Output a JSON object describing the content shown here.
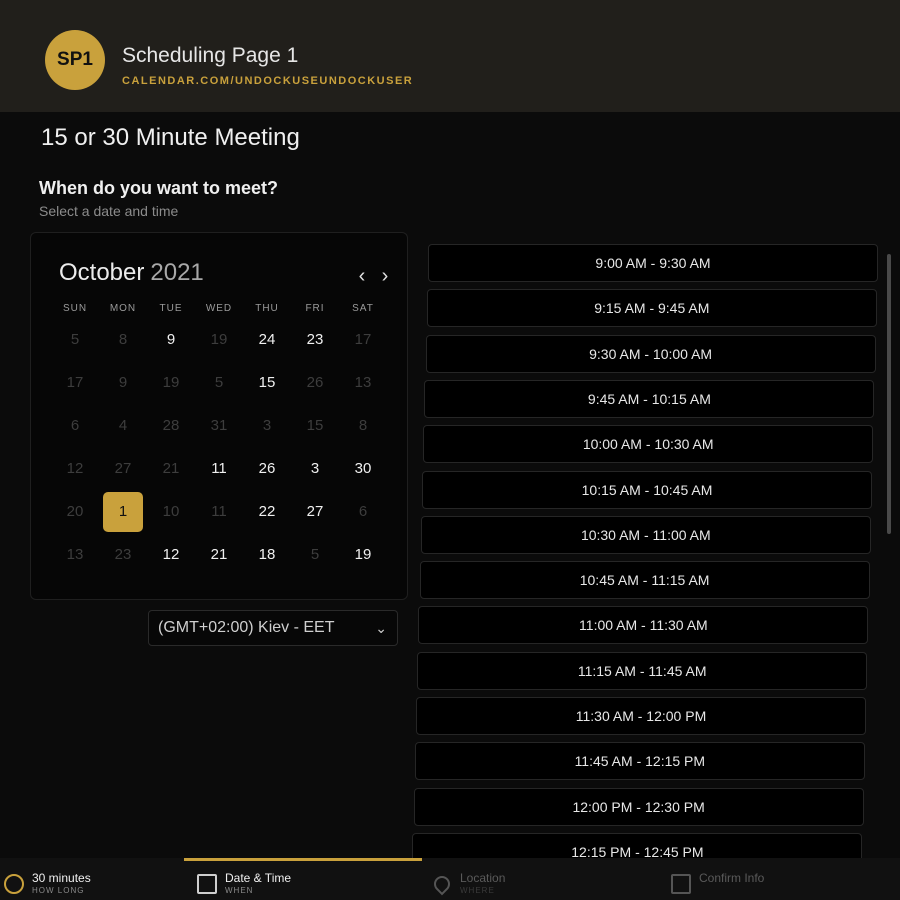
{
  "header": {
    "avatar_initials": "SP1",
    "page_name": "Scheduling Page 1",
    "page_url": "CALENDAR.COM/UNDOCKUSEUNDOCKUSER"
  },
  "meeting": {
    "title": "15 or 30 Minute Meeting",
    "question": "When do you want to meet?",
    "hint": "Select a date and time"
  },
  "calendar": {
    "month": "October",
    "year": "2021",
    "prev_icon": "‹",
    "next_icon": "›",
    "weekdays": [
      "SUN",
      "MON",
      "TUE",
      "WED",
      "THU",
      "FRI",
      "SAT"
    ],
    "weeks": [
      [
        {
          "d": "5",
          "a": false
        },
        {
          "d": "8",
          "a": false
        },
        {
          "d": "9",
          "a": true
        },
        {
          "d": "19",
          "a": false
        },
        {
          "d": "24",
          "a": true
        },
        {
          "d": "23",
          "a": true
        },
        {
          "d": "17",
          "a": false
        }
      ],
      [
        {
          "d": "17",
          "a": false
        },
        {
          "d": "9",
          "a": false
        },
        {
          "d": "19",
          "a": false
        },
        {
          "d": "5",
          "a": false
        },
        {
          "d": "15",
          "a": true
        },
        {
          "d": "26",
          "a": false
        },
        {
          "d": "13",
          "a": false
        }
      ],
      [
        {
          "d": "6",
          "a": false
        },
        {
          "d": "4",
          "a": false
        },
        {
          "d": "28",
          "a": false
        },
        {
          "d": "31",
          "a": false
        },
        {
          "d": "3",
          "a": false
        },
        {
          "d": "15",
          "a": false
        },
        {
          "d": "8",
          "a": false
        }
      ],
      [
        {
          "d": "12",
          "a": false
        },
        {
          "d": "27",
          "a": false
        },
        {
          "d": "21",
          "a": false
        },
        {
          "d": "11",
          "a": true
        },
        {
          "d": "26",
          "a": true
        },
        {
          "d": "3",
          "a": true
        },
        {
          "d": "30",
          "a": true
        }
      ],
      [
        {
          "d": "20",
          "a": false
        },
        {
          "d": "1",
          "a": true,
          "sel": true
        },
        {
          "d": "10",
          "a": false
        },
        {
          "d": "11",
          "a": false
        },
        {
          "d": "22",
          "a": true
        },
        {
          "d": "27",
          "a": true
        },
        {
          "d": "6",
          "a": false
        }
      ],
      [
        {
          "d": "13",
          "a": false
        },
        {
          "d": "23",
          "a": false
        },
        {
          "d": "12",
          "a": true
        },
        {
          "d": "21",
          "a": true
        },
        {
          "d": "18",
          "a": true
        },
        {
          "d": "5",
          "a": false
        },
        {
          "d": "19",
          "a": true
        }
      ]
    ]
  },
  "timezone": {
    "label": "(GMT+02:00) Kiev - EET",
    "chevron": "⌄"
  },
  "time_slots": [
    "9:00 AM - 9:30 AM",
    "9:15 AM - 9:45 AM",
    "9:30 AM - 10:00 AM",
    "9:45 AM - 10:15 AM",
    "10:00 AM - 10:30 AM",
    "10:15 AM - 10:45 AM",
    "10:30 AM - 11:00 AM",
    "10:45 AM - 11:15 AM",
    "11:00 AM - 11:30 AM",
    "11:15 AM - 11:45 AM",
    "11:30 AM - 12:00 PM",
    "11:45 AM - 12:15 PM",
    "12:00 PM - 12:30 PM",
    "12:15 PM - 12:45 PM"
  ],
  "steps": [
    {
      "label": "30 minutes",
      "sub": "HOW LONG",
      "icon": "clock-icon"
    },
    {
      "label": "Date & Time",
      "sub": "WHEN",
      "icon": "calendar-icon"
    },
    {
      "label": "Location",
      "sub": "WHERE",
      "icon": "location-pin-icon"
    },
    {
      "label": "Confirm Info",
      "sub": "",
      "icon": "checkbox-icon"
    }
  ],
  "colors": {
    "accent": "#c9a13c",
    "background": "#0b0b0b",
    "header": "#211f1b"
  }
}
